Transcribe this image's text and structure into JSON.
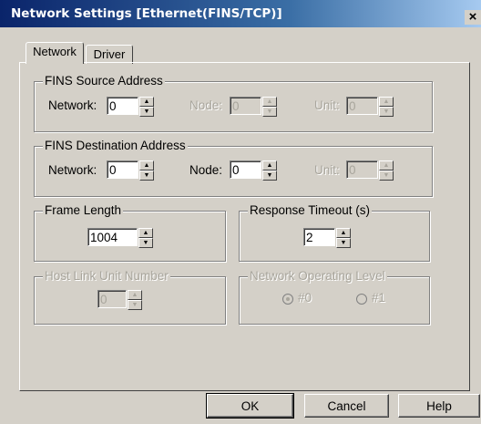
{
  "window": {
    "title": "Network Settings [Ethernet(FINS/TCP)]",
    "close_glyph": "×"
  },
  "tabs": [
    {
      "label": "Network",
      "active": true
    },
    {
      "label": "Driver",
      "active": false
    }
  ],
  "source": {
    "title": "FINS Source Address",
    "network": {
      "label": "Network:",
      "value": "0"
    },
    "node": {
      "label": "Node:",
      "value": "0",
      "disabled": true
    },
    "unit": {
      "label": "Unit:",
      "value": "0",
      "disabled": true
    }
  },
  "destination": {
    "title": "FINS Destination Address",
    "network": {
      "label": "Network:",
      "value": "0"
    },
    "node": {
      "label": "Node:",
      "value": "0"
    },
    "unit": {
      "label": "Unit:",
      "value": "0",
      "disabled": true
    }
  },
  "frame_length": {
    "title": "Frame Length",
    "value": "1004"
  },
  "response_timeout": {
    "title": "Response Timeout (s)",
    "value": "2"
  },
  "host_link": {
    "title": "Host Link Unit Number",
    "value": "0",
    "disabled": true
  },
  "operating_level": {
    "title": "Network Operating Level",
    "options": [
      {
        "label": "#0",
        "selected": true
      },
      {
        "label": "#1",
        "selected": false
      }
    ],
    "disabled": true
  },
  "buttons": {
    "ok": "OK",
    "cancel": "Cancel",
    "help": "Help"
  },
  "icons": {
    "spin_up": "▲",
    "spin_down": "▼"
  }
}
